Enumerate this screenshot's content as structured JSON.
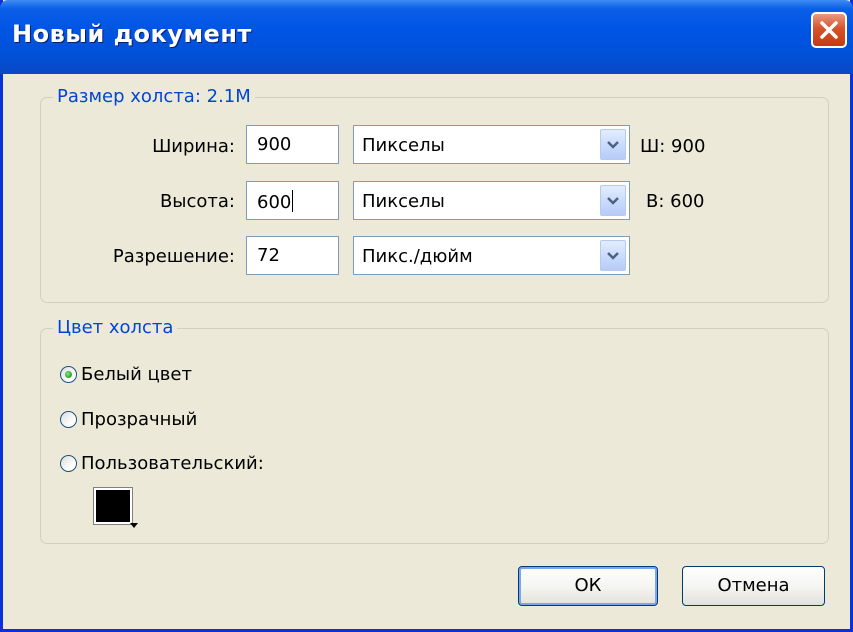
{
  "window": {
    "title": "Новый документ"
  },
  "canvas_size": {
    "group_title": "Размер холста: 2.1M",
    "width": {
      "label": "Ширина:",
      "value": "900",
      "unit": "Пикселы",
      "info": "Ш: 900"
    },
    "height": {
      "label": "Высота:",
      "value": "600",
      "unit": "Пикселы",
      "info": "В: 600"
    },
    "resolution": {
      "label": "Разрешение:",
      "value": "72",
      "unit": "Пикс./дюйм"
    }
  },
  "canvas_color": {
    "group_title": "Цвет холста",
    "options": [
      {
        "label": "Белый цвет",
        "selected": true
      },
      {
        "label": "Прозрачный",
        "selected": false
      },
      {
        "label": "Пользовательский:",
        "selected": false
      }
    ],
    "custom_color": "#000000"
  },
  "buttons": {
    "ok": "ОК",
    "cancel": "Отмена"
  },
  "colors": {
    "title_bar": "#0054e3",
    "group_title": "#0046d5",
    "dialog_bg": "#ece9d8",
    "close_button": "#d5532b"
  }
}
